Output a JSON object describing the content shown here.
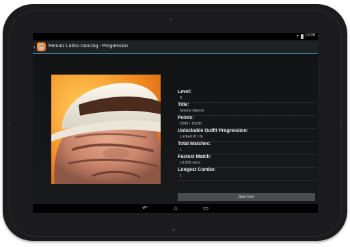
{
  "status_bar": {
    "time": "10:05"
  },
  "action_bar": {
    "title": "Fernutz Latino Dancing - Progression"
  },
  "progression": [
    {
      "label": "Level:",
      "value": "0"
    },
    {
      "label": "Title:",
      "value": "Novice Dancer"
    },
    {
      "label": "Points:",
      "value": "2500 / 15000"
    },
    {
      "label": "Unlockable Outfit Progression:",
      "value": "Locked (0 / 6)"
    },
    {
      "label": "Total Matches:",
      "value": "1"
    },
    {
      "label": "Fastest Match:",
      "value": "10.825 secs"
    },
    {
      "label": "Longest Combo:",
      "value": "1"
    }
  ],
  "start_over_label": "Start Over",
  "colors": {
    "accent": "#3aa1c8",
    "background": "#0f1012",
    "button": "#4a4c50"
  },
  "icons": [
    "back-icon",
    "app-icon",
    "wifi-icon",
    "battery-icon",
    "nav-back-icon",
    "nav-home-icon",
    "nav-recents-icon"
  ]
}
